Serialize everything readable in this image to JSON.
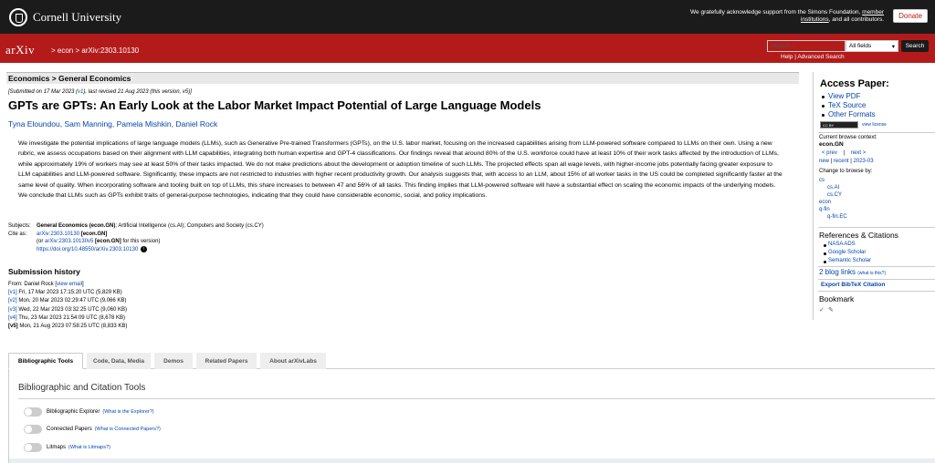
{
  "topbar": {
    "brand": "Cornell University",
    "ack_prefix": "We gratefully acknowledge support from the Simons Foundation,",
    "ack_link": "member institutions",
    "ack_suffix": ", and all contributors.",
    "donate_label": "Donate"
  },
  "header": {
    "logo": "arXiv",
    "crumb_sep1": ">",
    "crumb_econ": "econ",
    "crumb_sep2": ">",
    "crumb_id": "arXiv:2303.10130",
    "search_placeholder": "Search...",
    "search_field": "All fields",
    "search_button": "Search",
    "help_link": "Help",
    "help_sep": "|",
    "advanced_link": "Advanced Search"
  },
  "paper": {
    "category_header": "Economics > General Economics",
    "submitted_prefix": "[Submitted on 17 Mar 2023 (",
    "submitted_v1": "v1",
    "submitted_suffix": "), last revised 21 Aug 2023 (this version, v5)]",
    "title": "GPTs are GPTs: An Early Look at the Labor Market Impact Potential of Large Language Models",
    "authors": [
      "Tyna Eloundou",
      "Sam Manning",
      "Pamela Mishkin",
      "Daniel Rock"
    ],
    "abstract": "We investigate the potential implications of large language models (LLMs), such as Generative Pre-trained Transformers (GPTs), on the U.S. labor market, focusing on the increased capabilities arising from LLM-powered software compared to LLMs on their own. Using a new rubric, we assess occupations based on their alignment with LLM capabilities, integrating both human expertise and GPT-4 classifications. Our findings reveal that around 80% of the U.S. workforce could have at least 10% of their work tasks affected by the introduction of LLMs, while approximately 19% of workers may see at least 50% of their tasks impacted. We do not make predictions about the development or adoption timeline of such LLMs. The projected effects span all wage levels, with higher-income jobs potentially facing greater exposure to LLM capabilities and LLM-powered software. Significantly, these impacts are not restricted to industries with higher recent productivity growth. Our analysis suggests that, with access to an LLM, about 15% of all worker tasks in the US could be completed significantly faster at the same level of quality. When incorporating software and tooling built on top of LLMs, this share increases to between 47 and 56% of all tasks. This finding implies that LLM-powered software will have a substantial effect on scaling the economic impacts of the underlying models. We conclude that LLMs such as GPTs exhibit traits of general-purpose technologies, indicating that they could have considerable economic, social, and policy implications.",
    "subjects_label": "Subjects:",
    "subjects_primary": "General Economics (econ.GN)",
    "subjects_rest": "; Artificial Intelligence (cs.AI); Computers and Society (cs.CY)",
    "cite_label": "Cite as:",
    "cite_id": "arXiv:2303.10130",
    "cite_cat": " [econ.GN]",
    "cite_or_prefix": "(or ",
    "cite_or_id": "arXiv:2303.10130v5",
    "cite_or_cat": " [econ.GN]",
    "cite_or_suffix": " for this version)",
    "doi": "https://doi.org/10.48550/arXiv.2303.10130",
    "doi_icon": "i"
  },
  "history": {
    "title": "Submission history",
    "from_prefix": "From: Daniel Rock [",
    "from_link": "view email",
    "from_suffix": "]",
    "versions": [
      {
        "tag": "[v1]",
        "text": " Fri, 17 Mar 2023 17:15:20 UTC (5,829 KB)"
      },
      {
        "tag": "[v2]",
        "text": " Mon, 20 Mar 2023 02:29:47 UTC (9,066 KB)"
      },
      {
        "tag": "[v3]",
        "text": " Wed, 22 Mar 2023 03:32:25 UTC (9,060 KB)"
      },
      {
        "tag": "[v4]",
        "text": " Thu, 23 Mar 2023 21:54:09 UTC (8,678 KB)"
      },
      {
        "tag": "[v5]",
        "text": " Mon, 21 Aug 2023 07:58:25 UTC (8,833 KB)"
      }
    ]
  },
  "tabs": [
    "Bibliographic Tools",
    "Code, Data, Media",
    "Demos",
    "Related Papers",
    "About arXivLabs"
  ],
  "tools": {
    "title": "Bibliographic and Citation Tools",
    "items": [
      {
        "label": "Bibliographic Explorer",
        "help": "(What is the Explorer?)"
      },
      {
        "label": "Connected Papers",
        "help": "(What is Connected Papers?)"
      },
      {
        "label": "Litmaps",
        "help": "(What is Litmaps?)"
      }
    ]
  },
  "sidebar": {
    "access_title": "Access Paper:",
    "access_links": [
      "View PDF",
      "TeX Source",
      "Other Formats"
    ],
    "license_badge": "CC BY",
    "license_link": "view license",
    "browse_label": "Current browse context:",
    "browse_ctx": "econ.GN",
    "prev": "< prev",
    "nav_sep": "|",
    "next": "next >",
    "new": "new",
    "recent": "recent",
    "month": "2023-03",
    "change_label": "Change to browse by:",
    "browse_by": [
      "cs",
      "cs.AI",
      "cs.CY",
      "econ",
      "q-fin",
      "q-fin.EC"
    ],
    "refs_title": "References & Citations",
    "refs": [
      "NASA ADS",
      "Google Scholar",
      "Semantic Scholar"
    ],
    "blog_links": "2 blog links",
    "blog_what": "(what is this?)",
    "export": "Export BibTeX Citation",
    "bookmark_title": "Bookmark",
    "bookmark_icons": [
      "✓",
      "✎"
    ],
    "colors": {
      "red": "#b31b1b",
      "black": "#1b1b1b",
      "link": "#0645ad"
    }
  }
}
